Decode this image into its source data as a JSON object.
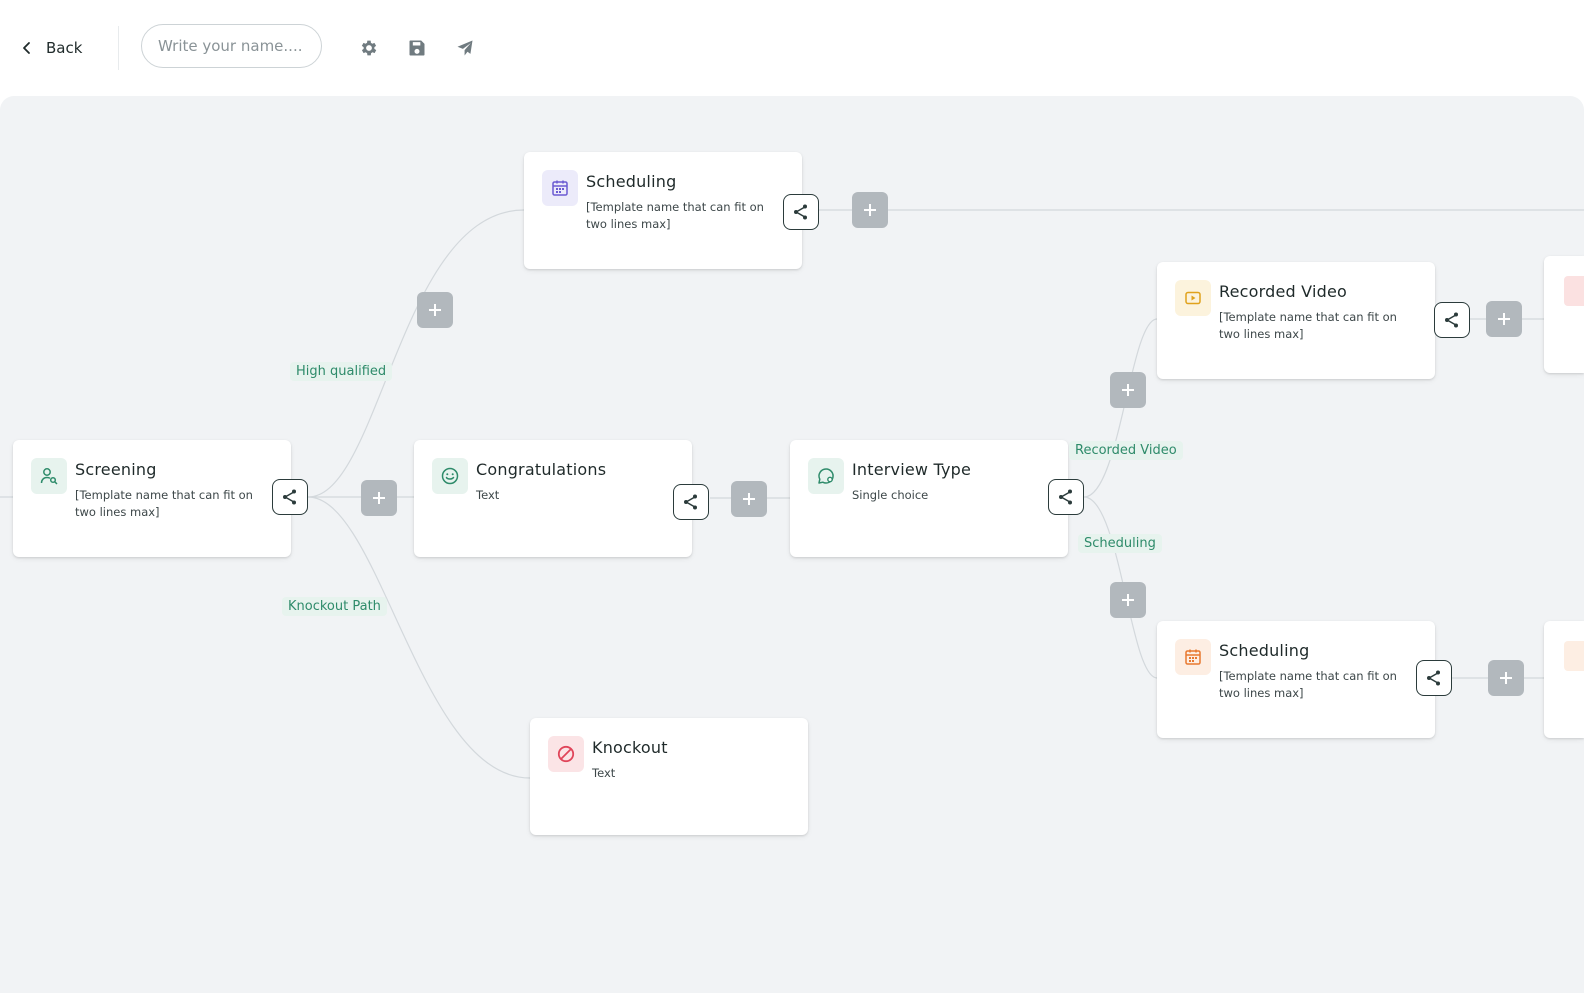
{
  "header": {
    "back_label": "Back",
    "name_placeholder": "Write your name....",
    "tools": [
      "gear-icon",
      "save-icon",
      "send-icon"
    ]
  },
  "colors": {
    "canvas_bg": "#f1f3f5",
    "edge_label_text": "#2e8b6a",
    "plus_button": "#b2b8bd",
    "scheduling_purple": "#6b5bd2",
    "scheduling_orange": "#e8782f",
    "recorded_video_yellow": "#e0a21c",
    "knockout_red": "#e0455a",
    "screening_green": "#2e8b6a"
  },
  "nodes": {
    "screening": {
      "title": "Screening",
      "subtitle": "[Template name that can fit on two lines max]",
      "icon": "user-search-icon"
    },
    "congratulations": {
      "title": "Congratulations",
      "subtitle": "Text",
      "icon": "smiley-icon"
    },
    "interview_type": {
      "title": "Interview Type",
      "subtitle": "Single choice",
      "icon": "chat-settings-icon"
    },
    "scheduling_top": {
      "title": "Scheduling",
      "subtitle": "[Template name that can fit on two lines max]",
      "icon": "calendar-icon"
    },
    "knockout": {
      "title": "Knockout",
      "subtitle": "Text",
      "icon": "block-icon"
    },
    "recorded_video": {
      "title": "Recorded Video",
      "subtitle": "[Template name that can fit on two lines max]",
      "icon": "video-icon"
    },
    "scheduling_bottom": {
      "title": "Scheduling",
      "subtitle": "[Template name that can fit on two lines max]",
      "icon": "calendar-icon"
    }
  },
  "edge_labels": {
    "high_qualified": "High qualified",
    "knockout_path": "Knockout Path",
    "recorded_video": "Recorded Video",
    "scheduling": "Scheduling"
  }
}
